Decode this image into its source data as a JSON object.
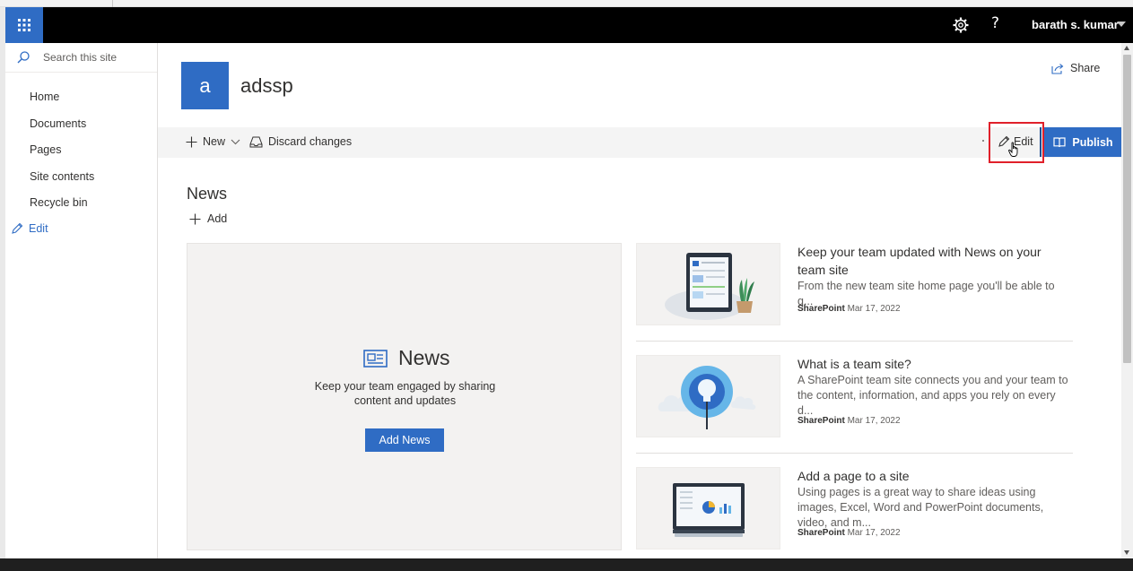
{
  "suitebar": {
    "app_launcher_icon": "waffle-icon",
    "settings_icon": "gear-icon",
    "help_label": "?",
    "user_name": "barath s. kumar",
    "accent_color": "#2f6cc4"
  },
  "leftnav": {
    "search_placeholder": "Search this site",
    "items": [
      {
        "label": "Home"
      },
      {
        "label": "Documents"
      },
      {
        "label": "Pages"
      },
      {
        "label": "Site contents"
      },
      {
        "label": "Recycle bin"
      }
    ],
    "edit_label": "Edit"
  },
  "site": {
    "logo_letter": "a",
    "title": "adssp",
    "share_label": "Share"
  },
  "commandbar": {
    "new_label": "New",
    "discard_label": "Discard changes",
    "edit_label": "Edit",
    "publish_label": "Publish"
  },
  "news": {
    "heading": "News",
    "add_label": "Add",
    "placeholder": {
      "title": "News",
      "description": "Keep your team engaged by sharing content and updates",
      "button_label": "Add News"
    },
    "articles": [
      {
        "title": "Keep your team updated with News on your team site",
        "description": "From the new team site home page you'll be able to q...",
        "author": "SharePoint",
        "date": "Mar 17, 2022",
        "thumbnail_icon": "tablet-plant-illustration"
      },
      {
        "title": "What is a team site?",
        "description": "A SharePoint team site connects you and your team to the content, information, and apps you rely on every d...",
        "author": "SharePoint",
        "date": "Mar 17, 2022",
        "thumbnail_icon": "lightbulb-illustration"
      },
      {
        "title": "Add a page to a site",
        "description": "Using pages is a great way to share ideas using images, Excel, Word and PowerPoint documents, video, and m...",
        "author": "SharePoint",
        "date": "Mar 17, 2022",
        "thumbnail_icon": "monitor-chart-illustration"
      }
    ]
  }
}
